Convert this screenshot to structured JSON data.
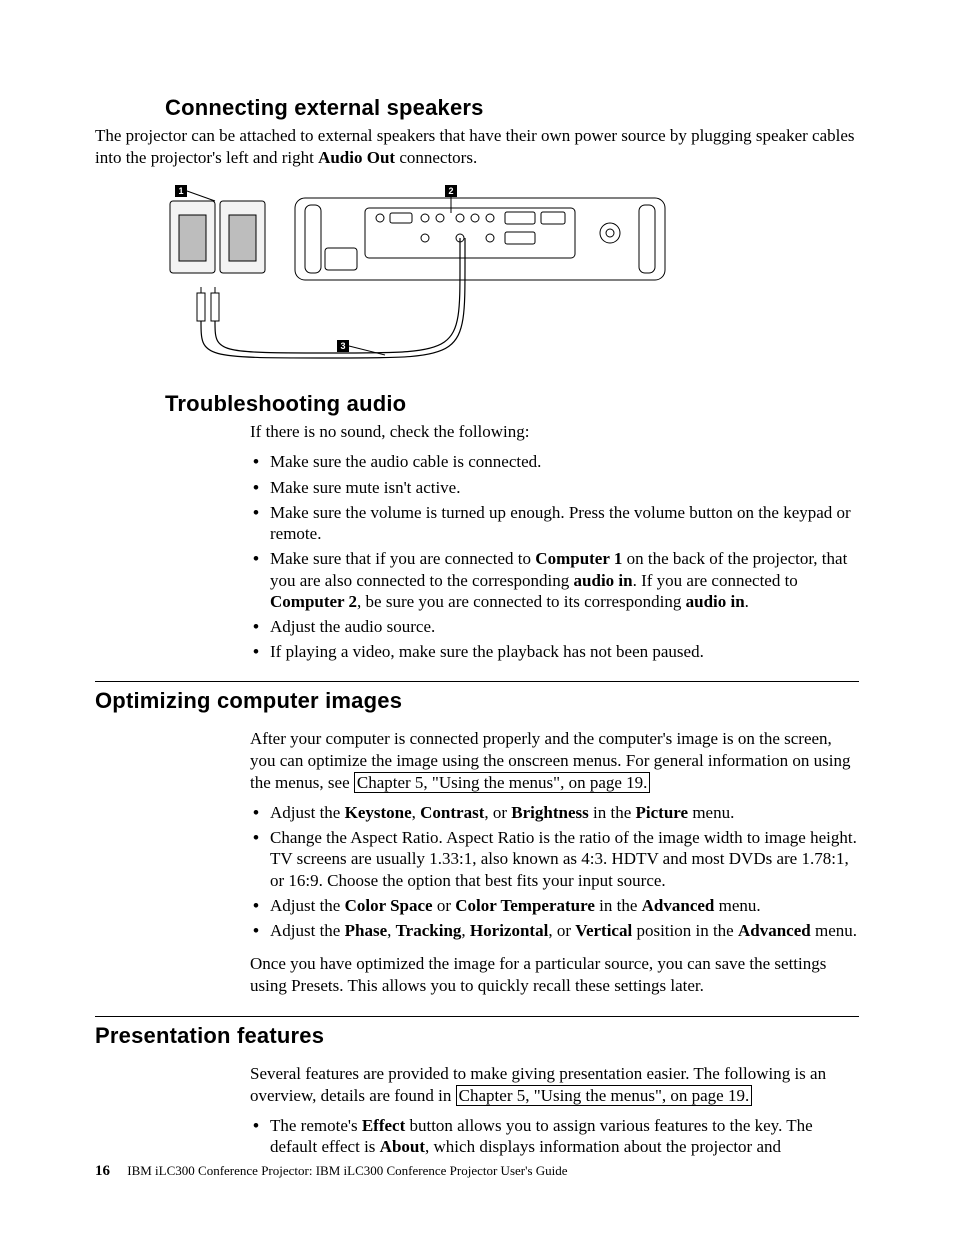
{
  "sections": {
    "s1": {
      "heading": "Connecting external speakers",
      "p1_a": "The projector can be attached to external speakers that have their own power source by plugging speaker cables into the projector's left and right ",
      "p1_b": "Audio Out",
      "p1_c": " connectors."
    },
    "s2": {
      "heading": "Troubleshooting audio",
      "p1": "If there is no sound, check the following:",
      "li1": "Make sure the audio cable is connected.",
      "li2": "Make sure mute isn't active.",
      "li3": "Make sure the volume is turned up enough. Press the volume button on the keypad or remote.",
      "li4_a": "Make sure that if you are connected to ",
      "li4_b": "Computer 1",
      "li4_c": " on the back of the projector, that you are also connected to the corresponding ",
      "li4_d": "audio in",
      "li4_e": ". If you are connected to ",
      "li4_f": "Computer 2",
      "li4_g": ", be sure you are connected to its corresponding ",
      "li4_h": "audio in",
      "li4_i": ".",
      "li5": "Adjust the audio source.",
      "li6": "If playing a video, make sure the playback has not been paused."
    },
    "s3": {
      "heading": "Optimizing computer images",
      "p1_a": "After your computer is connected properly and the computer's image is on the screen, you can optimize the image using the onscreen menus. For general information on using the menus, see ",
      "p1_link": "Chapter 5, \"Using the menus\", on page 19.",
      "li1_a": "Adjust the ",
      "li1_b": "Keystone",
      "li1_c": ", ",
      "li1_d": "Contrast",
      "li1_e": ", or ",
      "li1_f": "Brightness",
      "li1_g": " in the ",
      "li1_h": "Picture",
      "li1_i": " menu.",
      "li2": "Change the Aspect Ratio. Aspect Ratio is the ratio of the image width to image height. TV screens are usually 1.33:1, also known as 4:3. HDTV and most DVDs are 1.78:1, or 16:9. Choose the option that best fits your input source.",
      "li3_a": "Adjust the ",
      "li3_b": "Color Space",
      "li3_c": " or ",
      "li3_d": "Color Temperature",
      "li3_e": " in the ",
      "li3_f": "Advanced",
      "li3_g": " menu.",
      "li4_a": "Adjust the ",
      "li4_b": "Phase",
      "li4_c": ", ",
      "li4_d": "Tracking",
      "li4_e": ", ",
      "li4_f": "Horizontal",
      "li4_g": ", or ",
      "li4_h": "Vertical",
      "li4_i": " position in the ",
      "li4_j": "Advanced",
      "li4_k": " menu.",
      "p2": "Once you have optimized the image for a particular source, you can save the settings using Presets. This allows you to quickly recall these settings later."
    },
    "s4": {
      "heading": "Presentation features",
      "p1_a": "Several features are provided to make giving presentation easier. The following is an overview, details are found in ",
      "p1_link": "Chapter 5, \"Using the menus\", on page 19.",
      "li1_a": "The remote's ",
      "li1_b": "Effect",
      "li1_c": " button allows you to assign various features to the key. The default effect is ",
      "li1_d": "About",
      "li1_e": ", which displays information about the projector and"
    }
  },
  "figure": {
    "callout1": "1",
    "callout2": "2",
    "callout3": "3"
  },
  "footer": {
    "page": "16",
    "text": "IBM iLC300 Conference Projector: IBM iLC300 Conference Projector User's Guide"
  }
}
